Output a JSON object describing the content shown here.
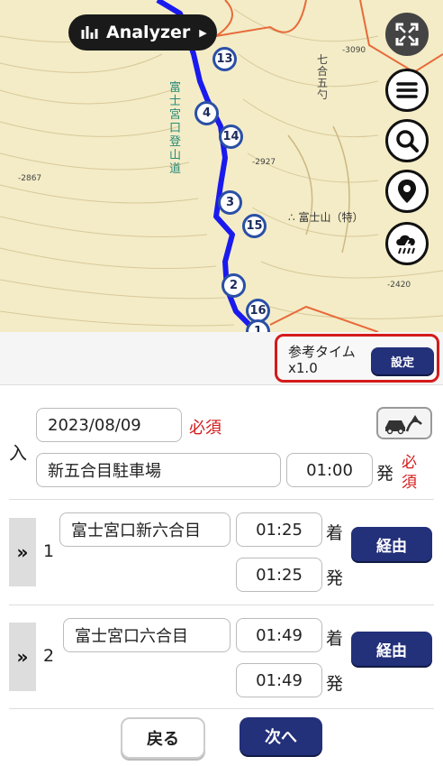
{
  "map": {
    "analyzer_label": "Analyzer",
    "play_icon": "▶",
    "labels": {
      "peak": "∴ 富士山（特）",
      "trail": "富士宮口登山道",
      "elev1": "-2867",
      "elev2": "-2927",
      "elev3": "-3090",
      "elev4": "-2420",
      "station": "七合五勺"
    },
    "waypoints": [
      {
        "label": "13"
      },
      {
        "label": "4"
      },
      {
        "label": "14"
      },
      {
        "label": "3"
      },
      {
        "label": "15"
      },
      {
        "label": "2"
      },
      {
        "label": "16"
      },
      {
        "label": "1"
      }
    ],
    "controls": [
      "fullscreen-icon",
      "menu-icon",
      "search-icon",
      "location-pin-icon",
      "weather-icon"
    ]
  },
  "reftime": {
    "label": "参考タイム",
    "value": "x1.0",
    "settings_button": "設定"
  },
  "start": {
    "side_label": "入",
    "date": "2023/08/09",
    "date_required": "必須",
    "place": "新五合目駐車場",
    "time": "01:00",
    "depart_label": "発",
    "required_1": "必",
    "required_2": "須"
  },
  "stops": [
    {
      "number": "1",
      "name": "富士宮口新六合目",
      "arrive_time": "01:25",
      "arrive_label": "着",
      "depart_time": "01:25",
      "depart_label": "発",
      "via_button": "経由"
    },
    {
      "number": "2",
      "name": "富士宮口六合目",
      "arrive_time": "01:49",
      "arrive_label": "着",
      "depart_time": "01:49",
      "depart_label": "発",
      "via_button": "経由"
    }
  ],
  "footer": {
    "back_button": "戻る",
    "next_button": "次へ"
  },
  "colors": {
    "route": "#1a1aee",
    "navy": "#23307a",
    "required_red": "#d41a1a",
    "map_bg": "#f3ecc6"
  }
}
